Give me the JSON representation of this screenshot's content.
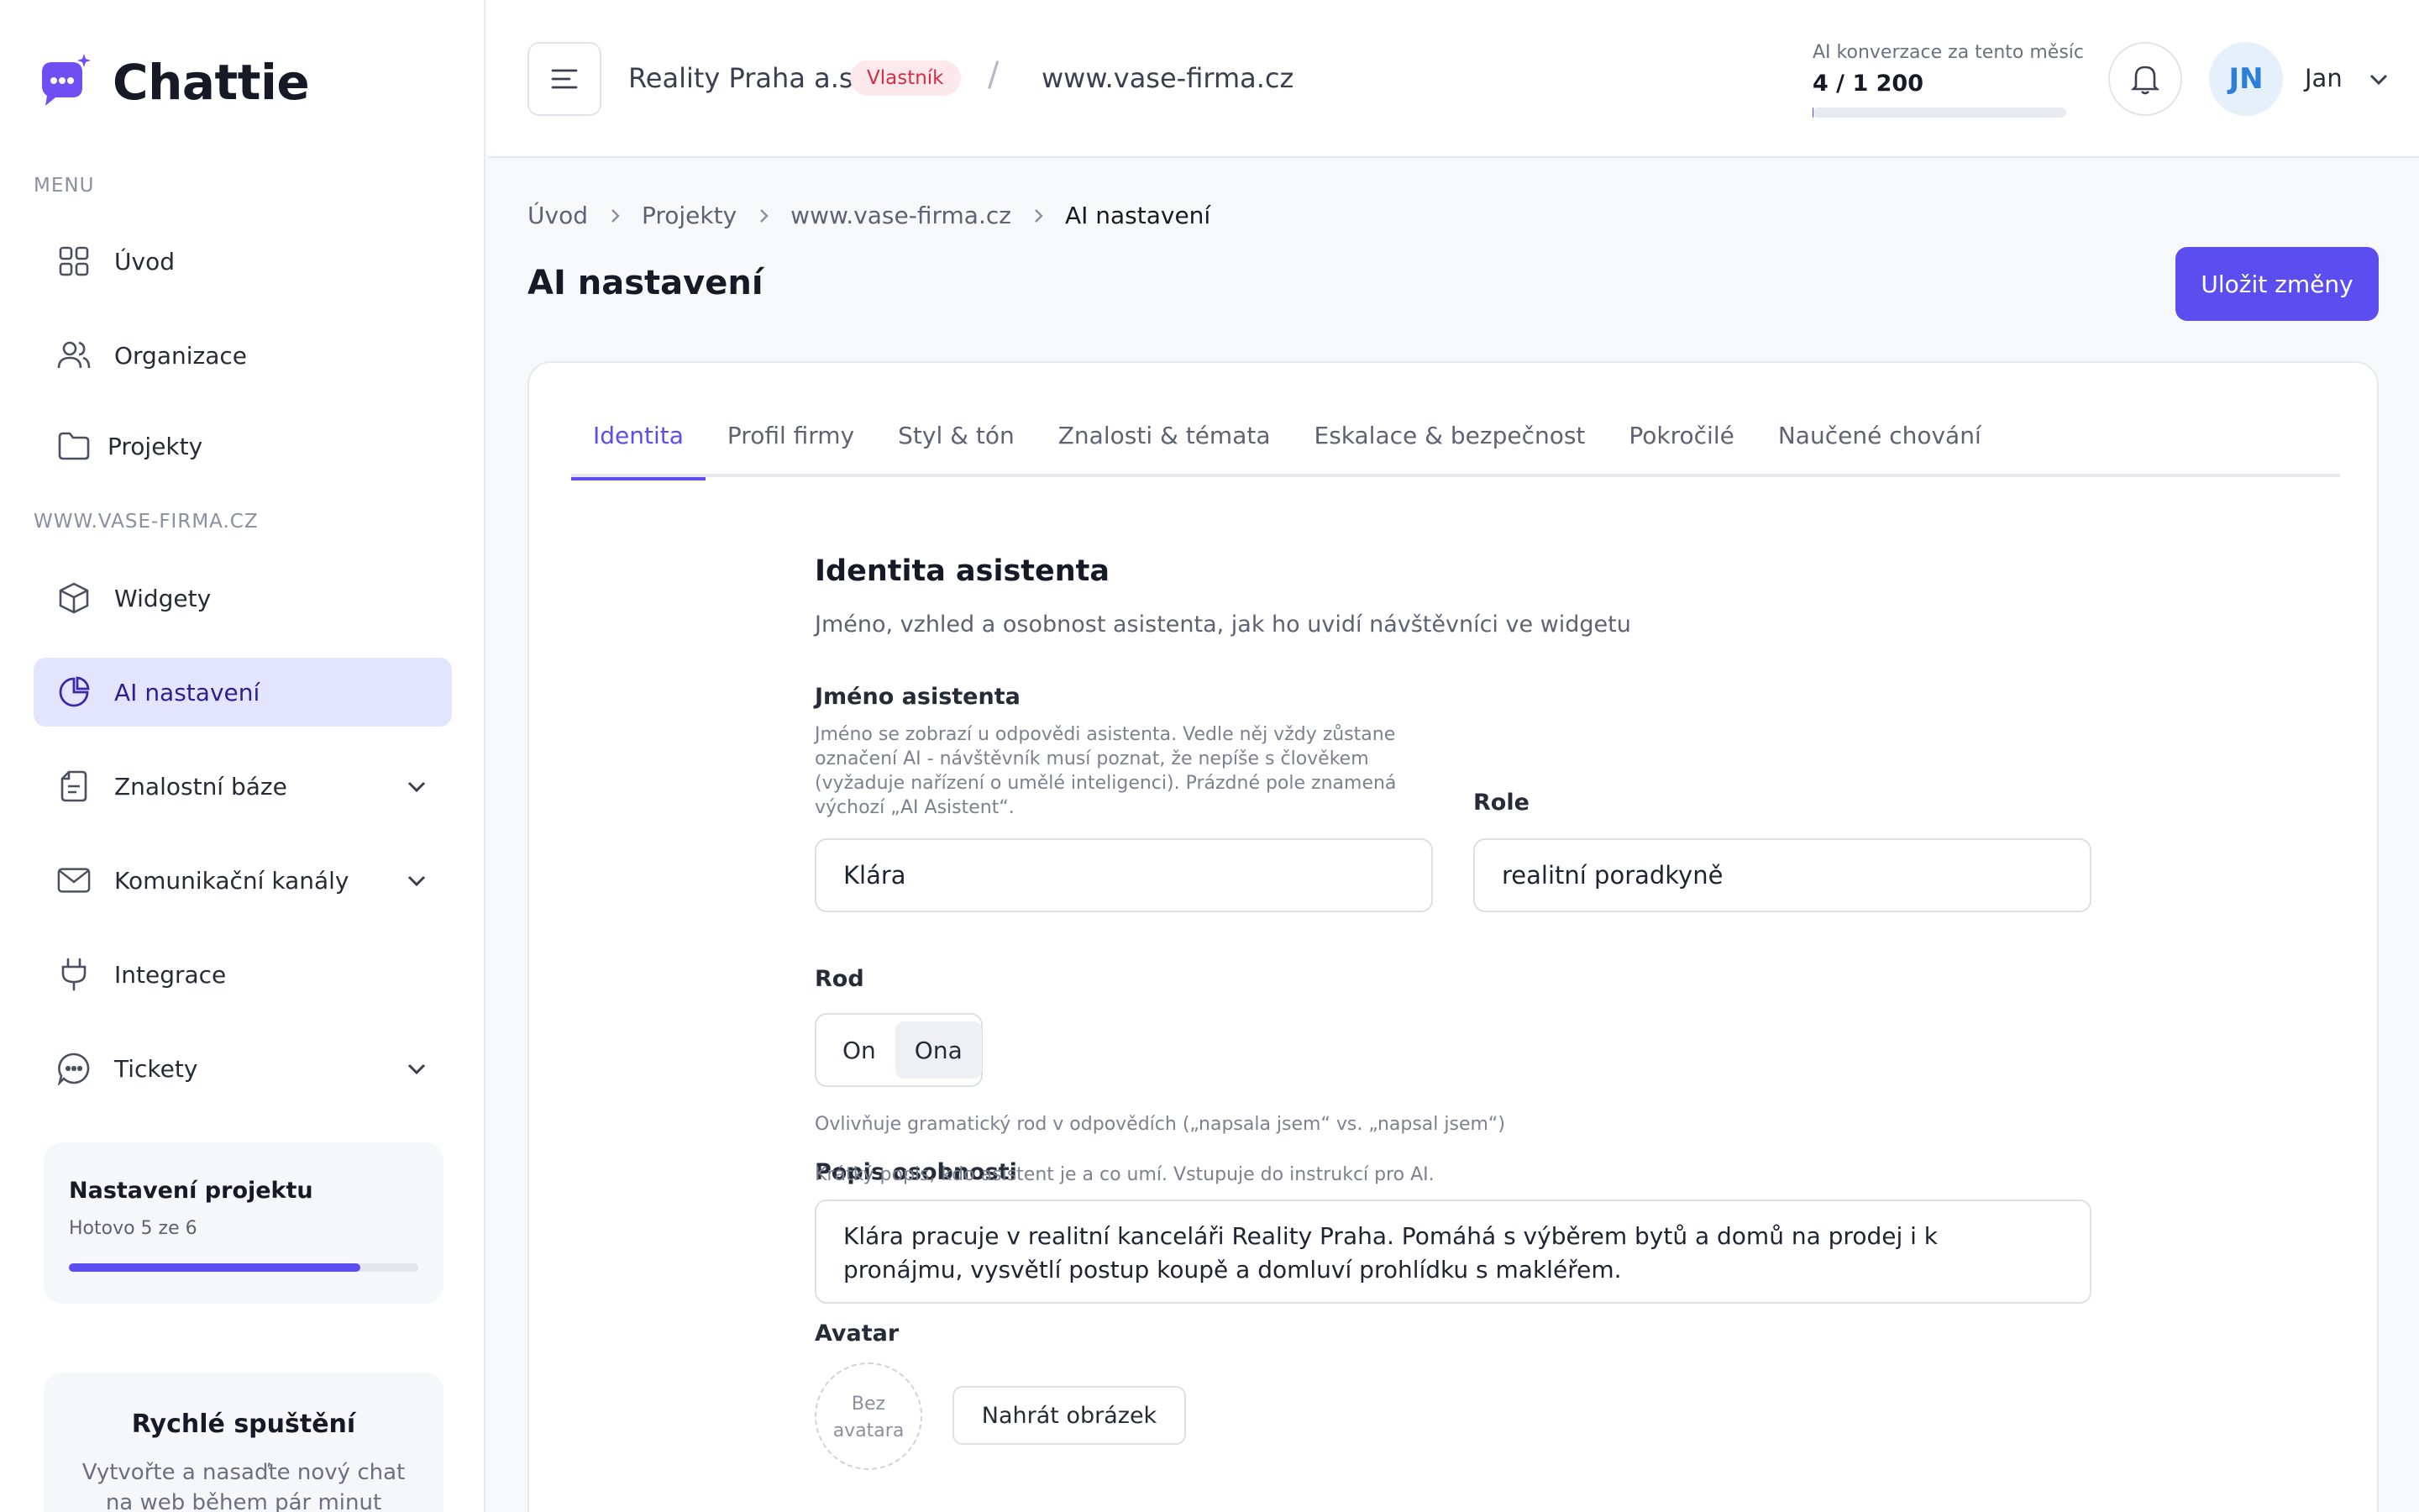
{
  "app": {
    "name": "Chattie"
  },
  "sidebar": {
    "menu_label": "MENU",
    "project_label": "WWW.VASE-FIRMA.CZ",
    "items": [
      {
        "label": "Úvod",
        "icon": "grid-icon"
      },
      {
        "label": "Organizace",
        "icon": "users-icon"
      },
      {
        "label": "Projekty",
        "icon": "folder-icon"
      },
      {
        "label": "Widgety",
        "icon": "cube-icon"
      },
      {
        "label": "AI nastavení",
        "icon": "pie-chart-icon",
        "active": true
      },
      {
        "label": "Znalostní báze",
        "icon": "document-icon",
        "expandable": true
      },
      {
        "label": "Komunikační kanály",
        "icon": "mail-icon",
        "expandable": true
      },
      {
        "label": "Integrace",
        "icon": "plug-icon"
      },
      {
        "label": "Tickety",
        "icon": "chat-bubble-icon",
        "expandable": true
      }
    ],
    "setup": {
      "title": "Nastavení projektu",
      "subtitle": "Hotovo 5 ze 6",
      "progress": 0.833
    },
    "quick": {
      "title": "Rychlé spuštění",
      "subtitle": "Vytvořte a nasaďte nový chat na web během pár minut"
    }
  },
  "header": {
    "org_name": "Reality Praha a.s.",
    "org_badge": "Vlastník",
    "site": "www.vase-firma.cz",
    "usage_label": "AI konverzace za tento měsíc",
    "usage_value": "4 / 1 200",
    "usage_used": 4,
    "usage_limit": 1200,
    "user_initials": "JN",
    "user_name": "Jan"
  },
  "breadcrumb": [
    "Úvod",
    "Projekty",
    "www.vase-firma.cz",
    "AI nastavení"
  ],
  "page": {
    "title": "AI nastavení",
    "save_label": "Uložit změny"
  },
  "tabs": [
    {
      "label": "Identita",
      "active": true
    },
    {
      "label": "Profil firmy"
    },
    {
      "label": "Styl & tón"
    },
    {
      "label": "Znalosti & témata"
    },
    {
      "label": "Eskalace & bezpečnost"
    },
    {
      "label": "Pokročilé"
    },
    {
      "label": "Naučené chování"
    }
  ],
  "form": {
    "title": "Identita asistenta",
    "description": "Jméno, vzhled a osobnost asistenta, jak ho uvidí návštěvníci ve widgetu",
    "name_label": "Jméno asistenta",
    "name_help": "Jméno se zobrazí u odpovědi asistenta. Vedle něj vždy zůstane označení AI - návštěvník musí poznat, že nepíše s člověkem (vyžaduje nařízení o umělé inteligenci). Prázdné pole znamená výchozí „AI Asistent“.",
    "name_value": "Klára",
    "role_label": "Role",
    "role_value": "realitní poradkyně",
    "gender_label": "Rod",
    "gender_options": [
      "On",
      "Ona"
    ],
    "gender_selected": "Ona",
    "gender_help": "Ovlivňuje gramatický rod v odpovědích („napsala jsem“ vs. „napsal jsem“)",
    "persona_label": "Popis osobnosti",
    "persona_help": "Krátký popis, kdo asistent je a co umí. Vstupuje do instrukcí pro AI.",
    "persona_value": "Klára pracuje v realitní kanceláři Reality Praha. Pomáhá s výběrem bytů a domů na prodej i k pronájmu, vysvětlí postup koupě a domluví prohlídku s makléřem.",
    "avatar_label": "Avatar",
    "avatar_placeholder_1": "Bez",
    "avatar_placeholder_2": "avatara",
    "upload_label": "Nahrát obrázek"
  },
  "colors": {
    "accent": "#5b4df0",
    "active_nav_bg": "#e3e4fd",
    "badge_text": "#d42d44",
    "badge_bg": "#fde9ec"
  }
}
